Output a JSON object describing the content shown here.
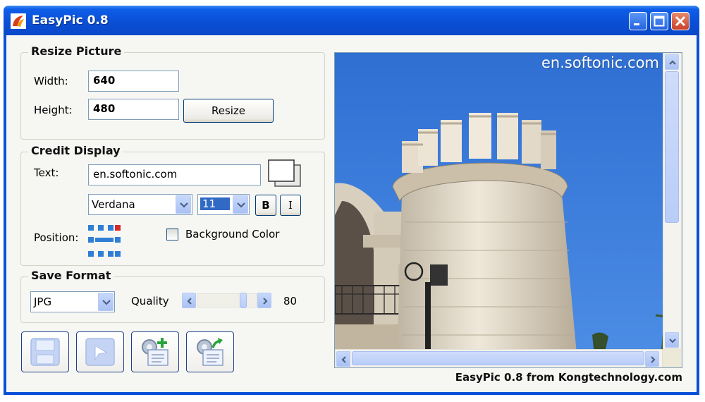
{
  "window": {
    "title": "EasyPic 0.8"
  },
  "resize": {
    "legend": "Resize Picture",
    "width_label": "Width:",
    "width_value": "640",
    "height_label": "Height:",
    "height_value": "480",
    "resize_button": "Resize"
  },
  "credit": {
    "legend": "Credit Display",
    "text_label": "Text:",
    "text_value": "en.softonic.com",
    "font_value": "Verdana",
    "size_value": "11",
    "bold_label": "B",
    "italic_label": "I",
    "position_label": "Position:",
    "background_label": "Background Color",
    "background_checked": false
  },
  "save": {
    "legend": "Save Format",
    "format_value": "JPG",
    "quality_label": "Quality",
    "quality_value": "80"
  },
  "preview": {
    "watermark": "en.softonic.com"
  },
  "footer": {
    "text": "EasyPic 0.8 from Kongtechnology.com"
  },
  "icons": {
    "toolbar": [
      "save-disk-icon",
      "play-arrow-icon",
      "add-batch-icon",
      "export-batch-icon"
    ],
    "caption": [
      "minimize-icon",
      "maximize-icon",
      "close-icon"
    ]
  }
}
